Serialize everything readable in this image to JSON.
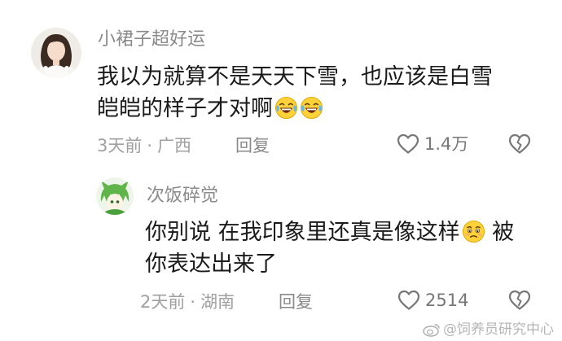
{
  "comments": [
    {
      "username": "小裙子超好运",
      "text_line1": "我以为就算不是天天下雪，也应该是白雪",
      "text_line2": "皑皑的样子才对啊",
      "emojis": [
        "laugh-cry-emoji",
        "laugh-cry-emoji"
      ],
      "time": "3天前",
      "location": "广西",
      "reply_label": "回复",
      "likes": "1.4万"
    },
    {
      "username": "次饭碎觉",
      "text_line1": "你别说 在我印象里还真是像这样",
      "text_line1_tail": " 被",
      "text_line2": "你表达出来了",
      "emojis": [
        "touched-emoji"
      ],
      "time": "2天前",
      "location": "湖南",
      "reply_label": "回复",
      "likes": "2514"
    }
  ],
  "separator": "·",
  "watermark": "@饲养员研究中心",
  "colors": {
    "text": "#1a1a1a",
    "username": "#8a8a8a",
    "meta": "#a0a0a0",
    "icon": "#777777"
  }
}
